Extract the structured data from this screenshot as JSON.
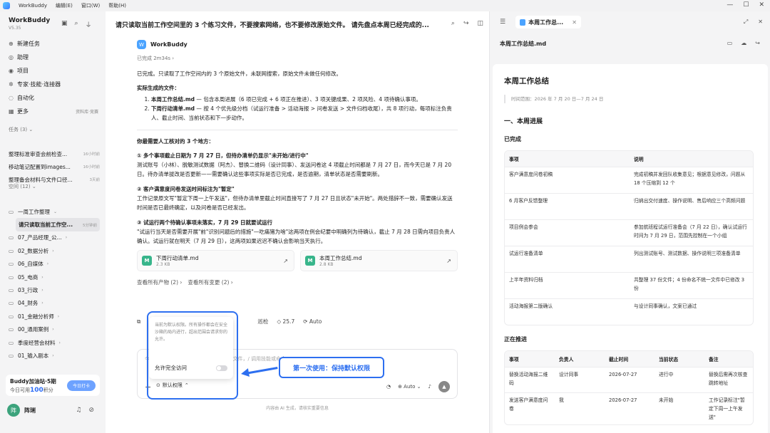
{
  "menubar": {
    "app": "WorkBuddy",
    "items": [
      "编辑(E)",
      "窗口(W)",
      "帮助(H)"
    ]
  },
  "sidebar": {
    "title": "WorkBuddy",
    "version": "V5.35",
    "nav": [
      {
        "label": "新建任务",
        "icon": "plus-circle-icon"
      },
      {
        "label": "助理",
        "icon": "assistant-icon"
      },
      {
        "label": "项目",
        "icon": "project-icon"
      },
      {
        "label": "专家·技能·连接器",
        "icon": "expert-icon"
      },
      {
        "label": "自动化",
        "icon": "automation-icon"
      },
      {
        "label": "更多",
        "icon": "grid-icon",
        "aux": "资料库·竞赛"
      }
    ],
    "tasks_title": "任务",
    "tasks_count": "(3)",
    "tasks": [
      {
        "label": "整理标准审查会前检查...",
        "time": "16小时前"
      },
      {
        "label": "移动笔记配置到images...",
        "time": "16小时前"
      },
      {
        "label": "整理备会材料与文件口径...",
        "time": "3天前"
      }
    ],
    "space_title": "空间",
    "space_count": "(12)",
    "spaces": [
      {
        "label": "一周工作整理"
      },
      {
        "label": "请只读取当前工作空...",
        "time": "5分钟前"
      },
      {
        "label": "07_产品经理_公..."
      },
      {
        "label": "02_数据分析"
      },
      {
        "label": "06_自媒体"
      },
      {
        "label": "05_电商"
      },
      {
        "label": "03_行政"
      },
      {
        "label": "04_财务"
      },
      {
        "label": "01_金融分析师"
      },
      {
        "label": "00_通用案例"
      },
      {
        "label": "季度经营会材料"
      },
      {
        "label": "01_输入剧本"
      }
    ],
    "promo": {
      "title": "Buddy加油站·5期",
      "text_pre": "今日可用",
      "points": "100",
      "text_post": "积分",
      "button": "今日打卡"
    },
    "user": {
      "name": "阵琍",
      "avatar": "阵"
    }
  },
  "main": {
    "header": "请只读取当前工作空间里的 3 个练习文件，不要搜索网络，也不要修改原始文件。 请先盘点本周已经完成的...",
    "bot_name": "WorkBuddy",
    "done": "已完成 2m34s",
    "summary": "已完成。只读取了工作空间内的 3 个原始文件，未联网搜索，原始文件未做任何修改。",
    "files_heading": "实际生成的文件：",
    "files_list": [
      {
        "name": "本周工作总结.md",
        "desc": " — 包含本周进展（6 项已完成 + 6 项正在推进）、3 项关键成果、2 项风险、4 项待确认事项。"
      },
      {
        "name": "下周行动清单.md",
        "desc": " — 按 4 个优先级分档（试运行准备 > 活动海报 > 问卷发送 > 文件归档收尾），共 8 项行动，每项标注负责人、截止时间、当前状态和下一步动作。"
      }
    ],
    "review_title": "你最需要人工核对的 3 个地方：",
    "points": [
      {
        "title": "① 多个事项截止日期为 7 月 27 日，但待办清单仍显示\"未开始/进行中\"",
        "body": "测试账号（小林）、脱敏测试数据（阿杰）、替换二维码（设计同事）、发送问卷这 4 项截止时间都是 7 月 27 日，而今天已是 7 月 20 日。待办清单拔改是否更新——需要确认这些事项实际是否已完成，是否逾期，清单状态是否需要刷新。"
      },
      {
        "title": "② 客户满意度问卷发送时间标注为\"暂定\"",
        "body": "工作记录原文写\"暂定下周一上午发送\"，但待办清单里截止时间直接写了 7 月 27 日且状态\"未开始\"。两处措辞不一致，需要确认发送时间是否已最终确定，以及问卷是否已经发出。"
      },
      {
        "title": "③ 试运行两个待确认事项未落实，7 月 29 日就要试运行",
        "body": "\"试运行当天是否需要开展\"前\"识别问题后的措施\"—吃痛猪为啥\"这两项在例会纪要中明确列为待确认，截止 7 月 28 日需向项目负责人确认。试运行就在明天（7 月 29 日），这两项如果迟迟不确认会影响当天执行。"
      }
    ],
    "file_cards": [
      {
        "name": "下周行动清单.md",
        "size": "2.3 KB",
        "icon": "M"
      },
      {
        "name": "本周工作总结.md",
        "size": "2.8 KB",
        "icon": "M"
      }
    ],
    "links": [
      "查看所有产物 (2) ›",
      "查看所有变更 (2) ›"
    ],
    "toolbar": {
      "score": "25.7",
      "mode": "Auto",
      "action": "巡检"
    },
    "composer_placeholder": "今天想让我帮你做点什么？输入 @ 引用文件，/ 调用技能或命令...",
    "permission_label": "默认权限",
    "model_label": "Auto",
    "footnote": "内容由 AI 生成，请核实重要信息"
  },
  "popup": {
    "desc": "当前为默认权限。所有操作都会在安全沙箱的局内进行，超出范围会请求你的允许。",
    "toggle_label": "允许完全访问"
  },
  "callout": "第一次使用：保持默认权限",
  "right": {
    "tab_label": "本周工作总...",
    "doc_name": "本周工作总结.md",
    "doc_title": "本周工作总结",
    "range": "时间范围：2026 年 7 月 20 日—7 月 24 日",
    "h2": "一、本周进展",
    "h3_done": "已完成",
    "table1": {
      "headers": [
        "事项",
        "说明"
      ],
      "rows": [
        [
          "客户满意度问卷初稿",
          "完成初稿并发回队收集意见；根据意见修改，问题从 18 个压缩到 12 个"
        ],
        [
          "6 月客户反馈整理",
          "归纳出交付速度、操作说明、售后响应三个高频问题"
        ],
        [
          "项目例会参会",
          "参加航班程试运行准备会（7 月 22 日），确认试运行时间为 7 月 29 日，范围先控制在一个小组"
        ],
        [
          "试运行准备清单",
          "列出测试账号、测试数据、操作说明三项准备清单"
        ],
        [
          "上半年资料归档",
          "共整理 37 份文件；4 份命名不统一文件中已修改 3 份"
        ],
        [
          "活动海报第二版确认",
          "与设计同事确认，文案已通过"
        ]
      ]
    },
    "h3_ongoing": "正在推进",
    "table2": {
      "headers": [
        "事项",
        "负责人",
        "截止时间",
        "当前状态",
        "备注"
      ],
      "rows": [
        [
          "替换活动海报二维码",
          "设计同事",
          "2026-07-27",
          "进行中",
          "替换后需再次核查跳转地址"
        ],
        [
          "发送客户满意度问卷",
          "我",
          "2026-07-27",
          "未开始",
          "工作记录标注\"暂定下周一上午发送\""
        ]
      ]
    }
  }
}
